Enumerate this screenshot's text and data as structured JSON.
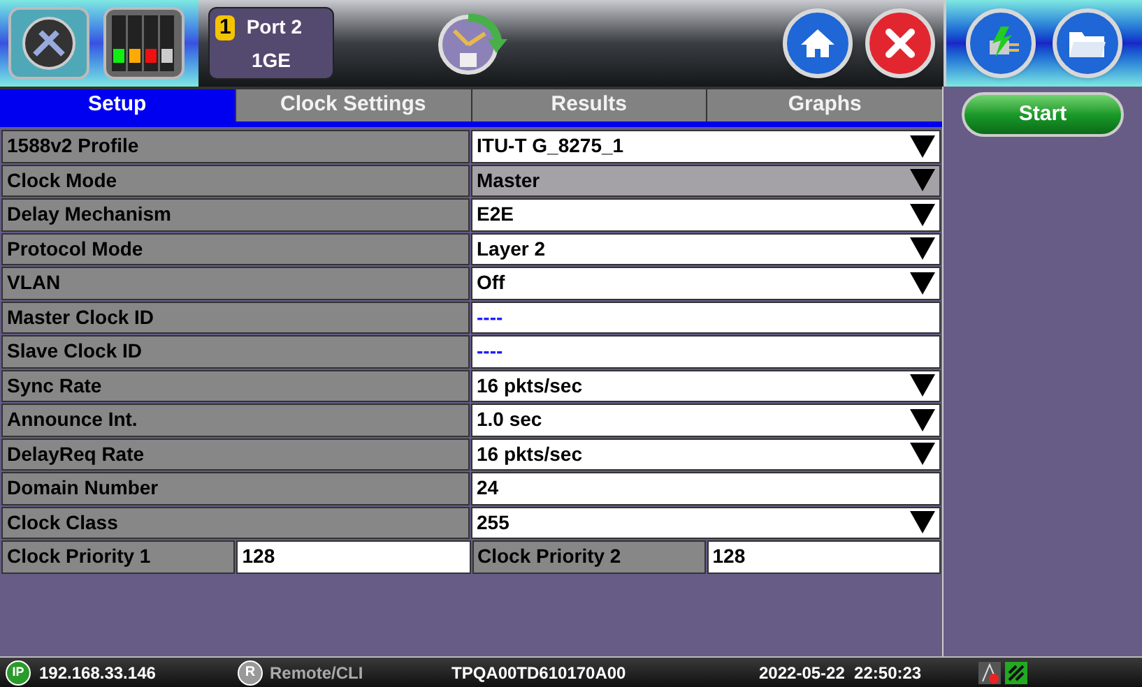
{
  "port": {
    "number": "1",
    "name": "Port 2",
    "rate": "1GE"
  },
  "tabs": [
    {
      "label": "Setup",
      "selected": true
    },
    {
      "label": "Clock Settings",
      "selected": false
    },
    {
      "label": "Results",
      "selected": false
    },
    {
      "label": "Graphs",
      "selected": false
    }
  ],
  "start_button": "Start",
  "rows": [
    {
      "kind": "dropdown",
      "label": "1588v2 Profile",
      "value": "ITU-T G_8275_1",
      "disabled": false
    },
    {
      "kind": "dropdown",
      "label": "Clock Mode",
      "value": "Master",
      "disabled": true
    },
    {
      "kind": "dropdown",
      "label": "Delay Mechanism",
      "value": "E2E",
      "disabled": false
    },
    {
      "kind": "dropdown",
      "label": "Protocol Mode",
      "value": "Layer 2",
      "disabled": false
    },
    {
      "kind": "dropdown",
      "label": "VLAN",
      "value": "Off",
      "disabled": false
    },
    {
      "kind": "readonly",
      "label": "Master Clock ID",
      "value": "----"
    },
    {
      "kind": "readonly",
      "label": "Slave Clock ID",
      "value": "----"
    },
    {
      "kind": "dropdown",
      "label": "Sync Rate",
      "value": "16 pkts/sec",
      "disabled": false
    },
    {
      "kind": "dropdown",
      "label": "Announce Int.",
      "value": "1.0 sec",
      "disabled": false
    },
    {
      "kind": "dropdown",
      "label": "DelayReq Rate",
      "value": "16 pkts/sec",
      "disabled": false
    },
    {
      "kind": "input",
      "label": "Domain Number",
      "value": "24"
    },
    {
      "kind": "dropdown",
      "label": "Clock Class",
      "value": "255",
      "disabled": false
    },
    {
      "kind": "pair",
      "label": "Clock Priority 1",
      "value": "128",
      "label_2": "Clock Priority 2",
      "value_2": "128"
    }
  ],
  "status_bar": {
    "ip_badge": "IP",
    "ip": "192.168.33.146",
    "remote_badge": "R",
    "remote": "Remote/CLI",
    "serial": "TPQA00TD610170A00",
    "datetime": "2022-05-22  22:50:23"
  }
}
